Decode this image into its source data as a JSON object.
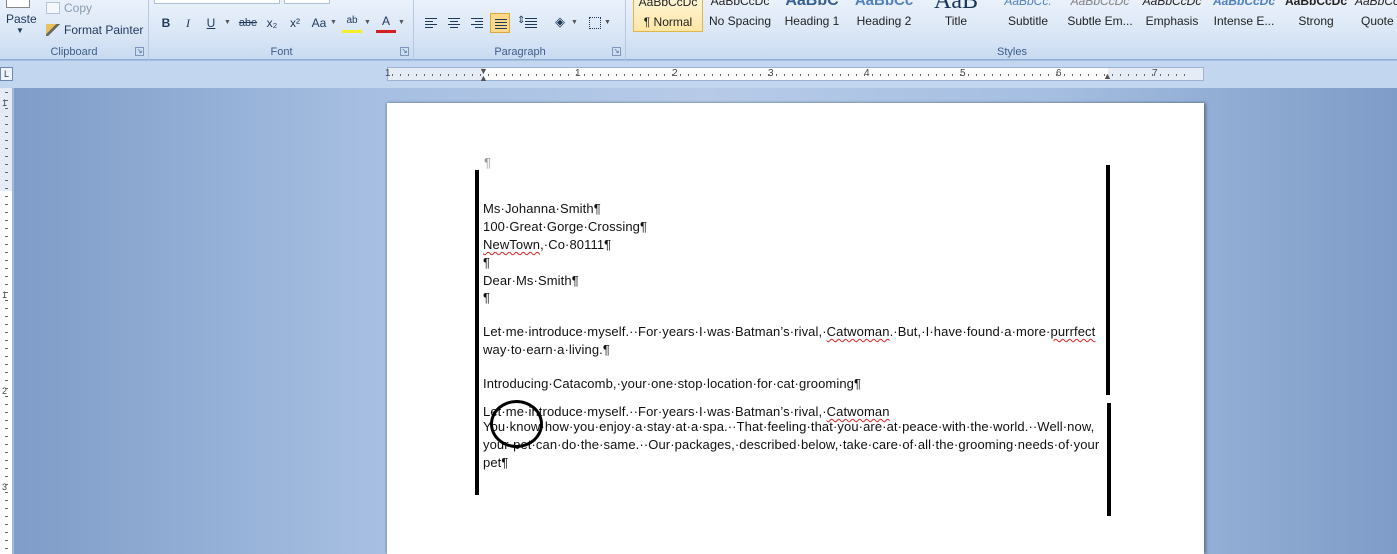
{
  "ribbon": {
    "clipboard": {
      "label": "Clipboard",
      "paste": "Paste",
      "copy": "Copy",
      "format_painter": "Format Painter"
    },
    "font": {
      "label": "Font",
      "buttons": [
        "B",
        "I",
        "U",
        "abe",
        "x₂",
        "x²",
        "Aa",
        "ab",
        "A"
      ]
    },
    "paragraph": {
      "label": "Paragraph"
    },
    "styles": {
      "label": "Styles",
      "items": [
        {
          "sample": "AaBbCcDc",
          "name": "¶ Normal"
        },
        {
          "sample": "AaBbCcDc",
          "name": "No Spacing"
        },
        {
          "sample": "AaBbC",
          "name": "Heading 1"
        },
        {
          "sample": "AaBbCc",
          "name": "Heading 2"
        },
        {
          "sample": "AaB",
          "name": "Title"
        },
        {
          "sample": "AaBbCc.",
          "name": "Subtitle"
        },
        {
          "sample": "AaBbCcDc",
          "name": "Subtle Em..."
        },
        {
          "sample": "AaBbCcDc",
          "name": "Emphasis"
        },
        {
          "sample": "AaBbCcDc",
          "name": "Intense E..."
        },
        {
          "sample": "AaBbCcDc",
          "name": "Strong"
        },
        {
          "sample": "AaBbCcDc",
          "name": "Quote"
        }
      ]
    }
  },
  "ruler": {
    "numbers": [
      "1",
      "1",
      "2",
      "3",
      "4",
      "5",
      "6",
      "7"
    ],
    "vnumbers": [
      "1",
      "1",
      "2",
      "3"
    ]
  },
  "tab_selector": "L",
  "document": {
    "lines": [
      {
        "text": "¶",
        "gray": true
      },
      {
        "text": "Ms·Johanna·Smith¶"
      },
      {
        "text": "100·Great·Gorge·Crossing¶"
      },
      {
        "text_a": "NewTown",
        "text_b": ",·Co·80111¶"
      },
      {
        "text": "¶"
      },
      {
        "text": "Dear·Ms·Smith¶"
      },
      {
        "text": "¶"
      },
      {
        "text_a": "Let·me·introduce·myself.··For·years·I·was·Batman’s·rival,·",
        "text_b": "Catwoman",
        "text_c": ".·But,·I·have·found·a·more·",
        "text_d": "purrfect"
      },
      {
        "text": "way·to·earn·a·living.¶"
      },
      {
        "text": "Introducing·Catacomb,·your·one·stop·location·for·cat·grooming¶"
      },
      {
        "text_a": "Let·me·introduce·myself.··For·years·I·was·Batman’s·rival,·",
        "text_b": "Catwoman"
      },
      {
        "text": "You·know·how·you·enjoy·a·stay·at·a·spa.··That·feeling·that·you·are·at·peace·with·the·world.··Well·now,"
      },
      {
        "text": "your·pet·can·do·the·same.··Our·packages,·described·below,·take·care·of·all·the·grooming·needs·of·your"
      },
      {
        "text": "pet¶"
      }
    ]
  }
}
